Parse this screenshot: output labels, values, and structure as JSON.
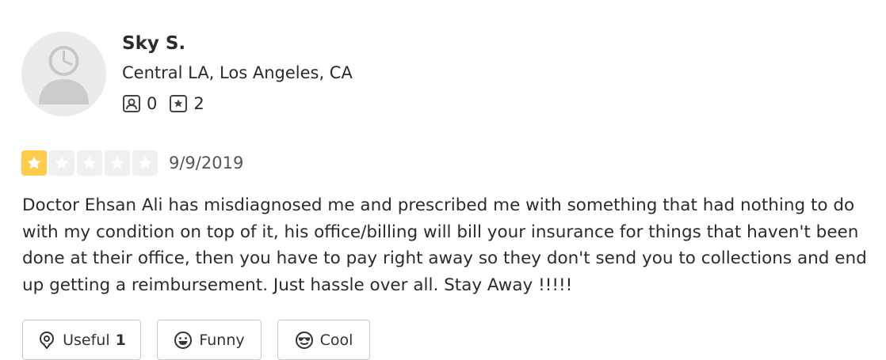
{
  "user": {
    "name": "Sky S.",
    "location": "Central LA, Los Angeles, CA",
    "friends_count": "0",
    "reviews_count": "2"
  },
  "review": {
    "rating": 1,
    "max_rating": 5,
    "date": "9/9/2019",
    "text": "Doctor Ehsan Ali has misdiagnosed me and prescribed me with something that had nothing to do with my condition on top of it, his office/billing will bill your insurance for things that haven't been done at their office, then you have to pay right away so they don't send you to collections and end up getting a reimbursement. Just hassle over all. Stay Away !!!!!"
  },
  "votes": {
    "useful_label": "Useful",
    "useful_count": "1",
    "funny_label": "Funny",
    "cool_label": "Cool"
  },
  "colors": {
    "star_filled": "#ffcc4b",
    "star_empty": "#f0f0f0",
    "avatar_bg": "#ebebeb",
    "avatar_fg": "#cccccc"
  }
}
